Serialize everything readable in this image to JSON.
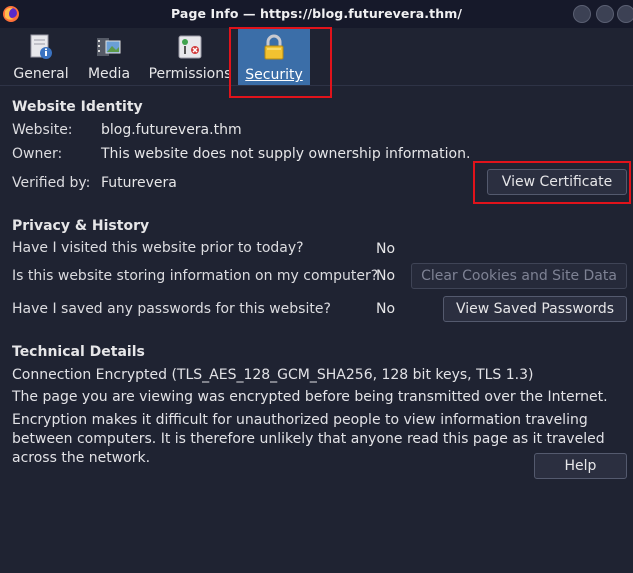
{
  "window": {
    "title": "Page Info — https://blog.futurevera.thm/"
  },
  "tabs": [
    {
      "label": "General",
      "icon": "info-page-icon",
      "selected": false
    },
    {
      "label": "Media",
      "icon": "media-icon",
      "selected": false
    },
    {
      "label": "Permissions",
      "icon": "permissions-icon",
      "selected": false
    },
    {
      "label": "Security",
      "icon": "lock-icon",
      "selected": true
    }
  ],
  "identity": {
    "heading": "Website Identity",
    "website_label": "Website:",
    "website_value": "blog.futurevera.thm",
    "owner_label": "Owner:",
    "owner_value": "This website does not supply ownership information.",
    "verified_label": "Verified by:",
    "verified_value": "Futurevera",
    "view_certificate": "View Certificate"
  },
  "privacy": {
    "heading": "Privacy & History",
    "q1": "Have I visited this website prior to today?",
    "a1": "No",
    "q2": "Is this website storing information on my computer?",
    "a2": "No",
    "clear_cookies": "Clear Cookies and Site Data",
    "q3": "Have I saved any passwords for this website?",
    "a3": "No",
    "view_passwords": "View Saved Passwords"
  },
  "technical": {
    "heading": "Technical Details",
    "line1": "Connection Encrypted (TLS_AES_128_GCM_SHA256, 128 bit keys, TLS 1.3)",
    "line2": "The page you are viewing was encrypted before being transmitted over the Internet.",
    "line3": "Encryption makes it difficult for unauthorized people to view information traveling between computers. It is therefore unlikely that anyone read this page as it traveled across the network."
  },
  "help": "Help",
  "colors": {
    "background": "#1f2332",
    "selected_tab": "#3b6ea8",
    "highlight_box": "#e0131b"
  }
}
